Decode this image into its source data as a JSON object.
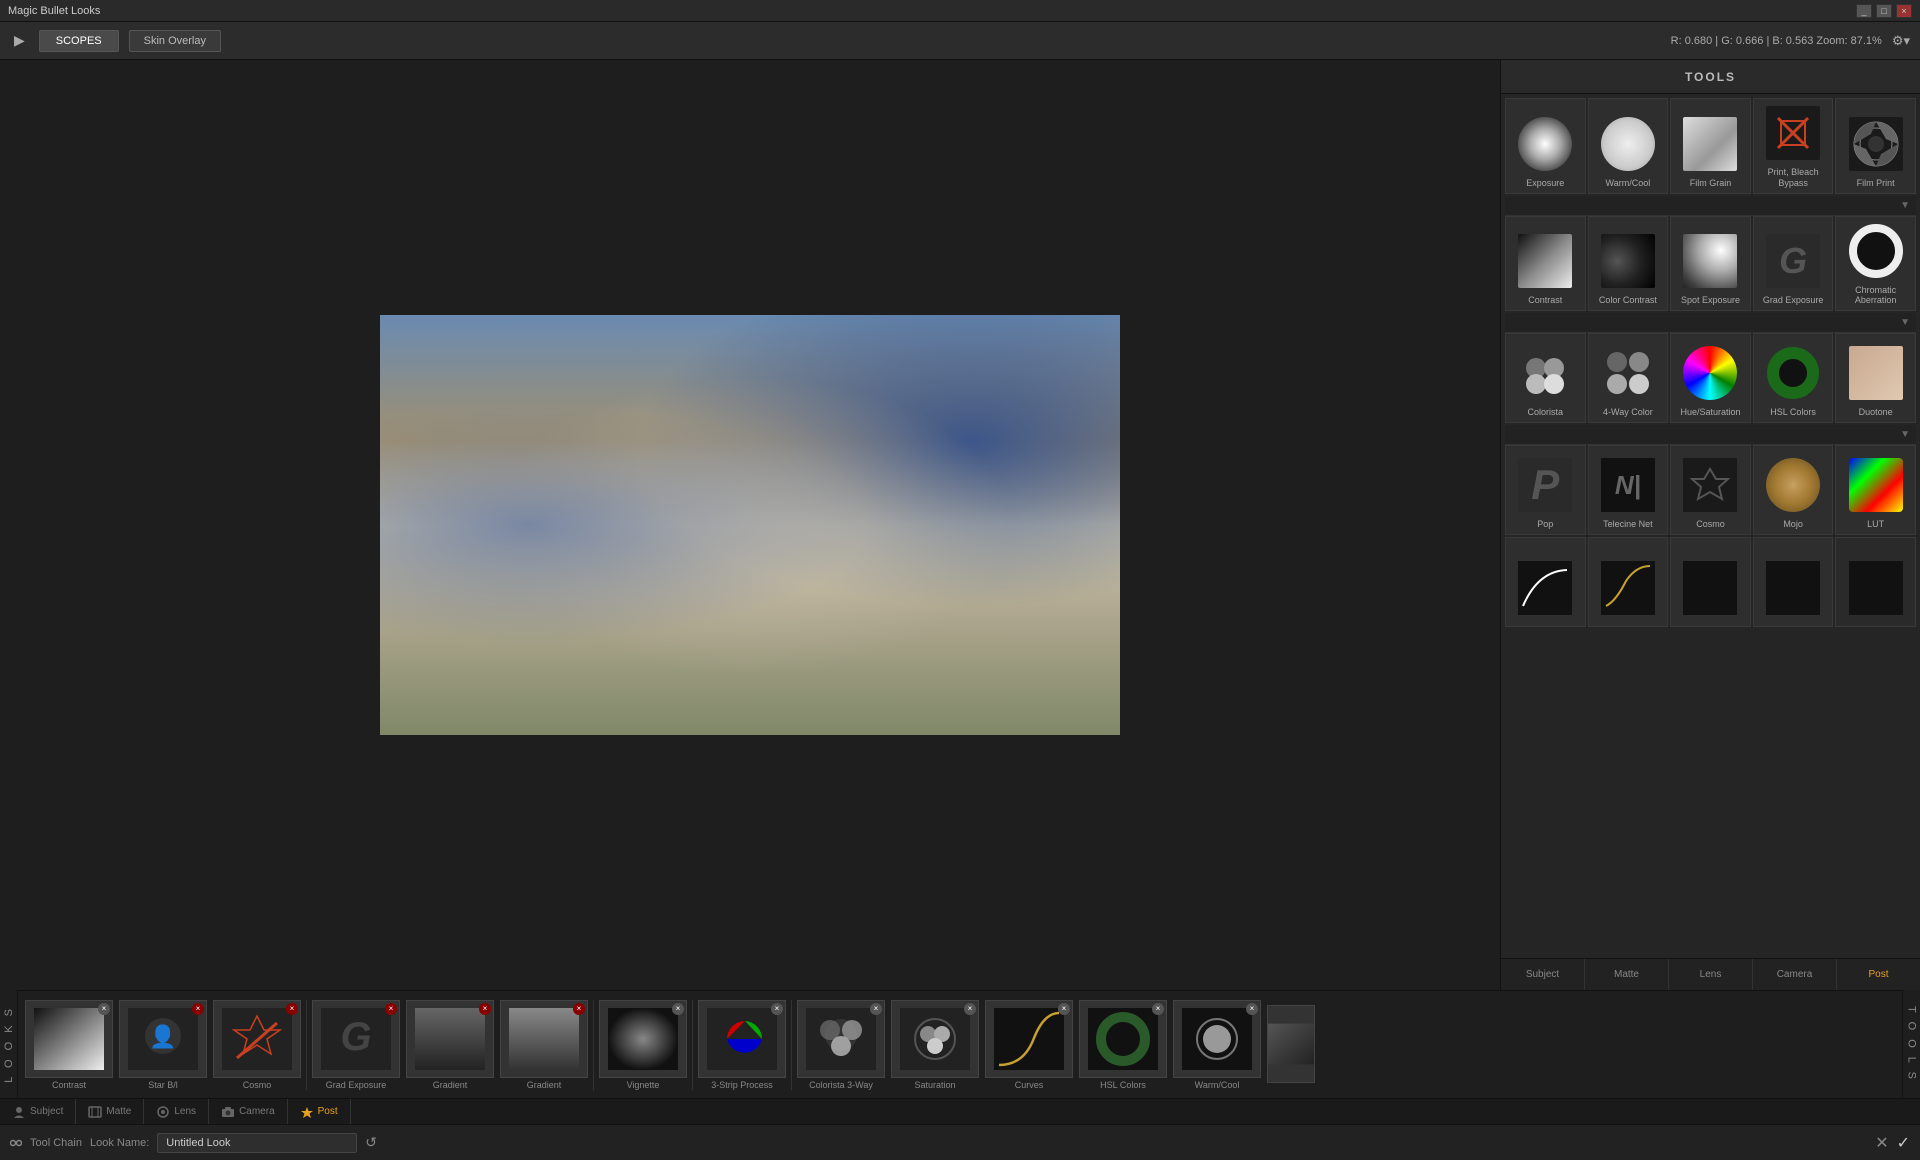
{
  "titlebar": {
    "title": "Magic Bullet Looks",
    "buttons": [
      "_",
      "□",
      "×"
    ]
  },
  "topbar": {
    "arrow": "▶",
    "tabs": [
      {
        "label": "SCOPES",
        "active": true
      },
      {
        "label": "Skin Overlay",
        "active": false
      }
    ],
    "info": "R: 0.680 | G: 0.666 | B: 0.563   Zoom: 87.1%",
    "gear": "⚙"
  },
  "tools": {
    "header": "TOOLS",
    "tabs": [
      {
        "label": "Subject",
        "active": false
      },
      {
        "label": "Matte",
        "active": false
      },
      {
        "label": "Lens",
        "active": false
      },
      {
        "label": "Camera",
        "active": false
      },
      {
        "label": "Post",
        "active": true
      }
    ],
    "items_row1": [
      {
        "id": "exposure",
        "label": "Exposure"
      },
      {
        "id": "warmcool",
        "label": "Warm/Cool"
      },
      {
        "id": "filmgrain",
        "label": "Film Grain"
      },
      {
        "id": "printbleach",
        "label": "Print, Bleach Bypass"
      },
      {
        "id": "filmprint",
        "label": "Film Print"
      }
    ],
    "items_row2": [
      {
        "id": "contrast",
        "label": "Contrast"
      },
      {
        "id": "colorcontrast",
        "label": "Color Contrast"
      },
      {
        "id": "spotexposure",
        "label": "Spot Exposure"
      },
      {
        "id": "gradexposure",
        "label": "Grad Exposure"
      },
      {
        "id": "chromaticab",
        "label": "Chromatic Aberration"
      }
    ],
    "items_row3": [
      {
        "id": "colorista",
        "label": "Colorista"
      },
      {
        "id": "4waycolor",
        "label": "4-Way Color"
      },
      {
        "id": "huesat",
        "label": "Hue/Saturation"
      },
      {
        "id": "hslcolors",
        "label": "HSL Colors"
      },
      {
        "id": "duotone",
        "label": "Duotone"
      }
    ],
    "items_row4": [
      {
        "id": "pop",
        "label": "Pop"
      },
      {
        "id": "telecinenet",
        "label": "Telecine Net"
      },
      {
        "id": "cosmo",
        "label": "Cosmo"
      },
      {
        "id": "mojo",
        "label": "Mojo"
      },
      {
        "id": "lut",
        "label": "LUT"
      }
    ],
    "items_row5": [
      {
        "id": "subject-tool",
        "label": ""
      },
      {
        "id": "matte-tool",
        "label": ""
      },
      {
        "id": "lens-tool",
        "label": ""
      },
      {
        "id": "camera-tool",
        "label": ""
      },
      {
        "id": "post-tool",
        "label": ""
      }
    ]
  },
  "filmstrip": {
    "items": [
      {
        "id": "contrast-film",
        "label": "Contrast",
        "has_close": true,
        "close_color": "gray"
      },
      {
        "id": "star-film",
        "label": "Star B/l",
        "has_close": true,
        "close_color": "red"
      },
      {
        "id": "cosmo-film",
        "label": "Cosmo",
        "has_close": true,
        "close_color": "red"
      },
      {
        "id": "grad-film",
        "label": "Grad Exposure",
        "has_close": true,
        "close_color": "red"
      },
      {
        "id": "gradient-film",
        "label": "Gradient",
        "has_close": true,
        "close_color": "red"
      },
      {
        "id": "gradient2-film",
        "label": "Gradient",
        "has_close": true,
        "close_color": "red"
      },
      {
        "id": "vignette-film",
        "label": "Vignette",
        "has_close": true,
        "close_color": "gray"
      },
      {
        "id": "3strip-film",
        "label": "3-Strip Process",
        "has_close": true,
        "close_color": "gray"
      },
      {
        "id": "colorista3way-film",
        "label": "Colorista 3-Way",
        "has_close": true,
        "close_color": "gray"
      },
      {
        "id": "saturation-film",
        "label": "Saturation",
        "has_close": true,
        "close_color": "gray"
      },
      {
        "id": "curves-film",
        "label": "Curves",
        "has_close": true,
        "close_color": "gray"
      },
      {
        "id": "hslcolors-film",
        "label": "HSL Colors",
        "has_close": true,
        "close_color": "gray"
      },
      {
        "id": "warmcool-film",
        "label": "Warm/Cool",
        "has_close": true,
        "close_color": "gray"
      }
    ]
  },
  "sectionlabels": [
    {
      "id": "subject-label",
      "label": "Subject",
      "icon": "person",
      "active": false
    },
    {
      "id": "matte-label",
      "label": "Matte",
      "icon": "film",
      "active": false
    },
    {
      "id": "lens-label",
      "label": "Lens",
      "icon": "lens",
      "active": false
    },
    {
      "id": "camera-label",
      "label": "Camera",
      "icon": "camera",
      "active": false
    },
    {
      "id": "post-label",
      "label": "Post",
      "icon": "star",
      "active": true
    }
  ],
  "lookchain": {
    "chain_label": "Tool Chain",
    "name_label": "Look Name:",
    "name_value": "Untitled Look",
    "reset": "↺",
    "close": "✕",
    "confirm": "✓"
  }
}
